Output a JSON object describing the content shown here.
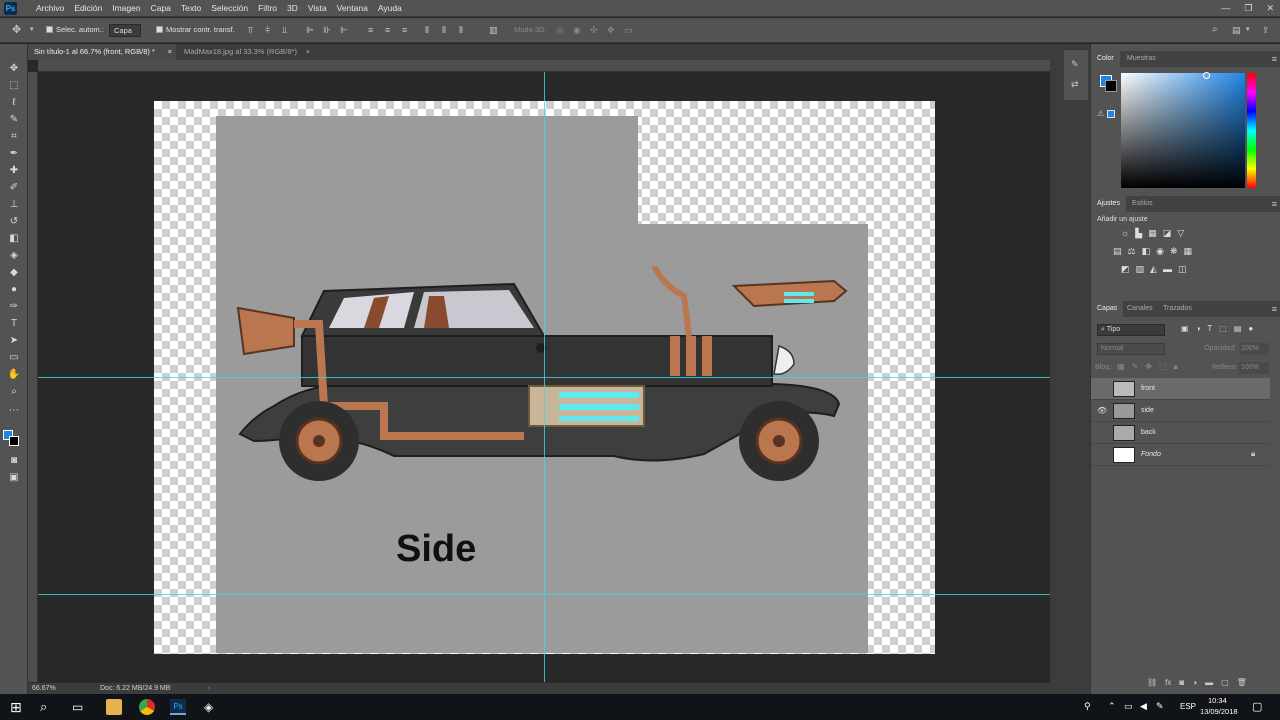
{
  "app": {
    "logo": "Ps"
  },
  "menu": [
    "Archivo",
    "Edición",
    "Imagen",
    "Capa",
    "Texto",
    "Selección",
    "Filtro",
    "3D",
    "Vista",
    "Ventana",
    "Ayuda"
  ],
  "window_controls": [
    "—",
    "❐",
    "✕"
  ],
  "options_bar": {
    "auto_select_label": "Selec. autom.:",
    "auto_select_value": "Capa",
    "show_transform_label": "Mostrar contr. transf.",
    "mode_3d_label": "Modo 3D:"
  },
  "tabs": [
    {
      "label": "Sin título-1 al 66.7% (front, RGB/8) *",
      "close": "×"
    },
    {
      "label": "MadMax18.jpg al 33.3% (RGB/8*)",
      "close": "×"
    }
  ],
  "canvas": {
    "text": "Side"
  },
  "status": {
    "zoom": "66.67%",
    "doc": "Doc: 6.22 MB/24.9 MB"
  },
  "color_panel": {
    "tabs": [
      "Color",
      "Muestras"
    ],
    "fg_color": "#1e86e6",
    "bg_color": "#000000"
  },
  "adjust_panel": {
    "tabs": [
      "Ajustes",
      "Estilos"
    ],
    "add_label": "Añadir un ajuste"
  },
  "layers_panel": {
    "tabs": [
      "Capas",
      "Canales",
      "Trazados"
    ],
    "filter_label": "Tipo",
    "blend_mode": "Normal",
    "opacity_label": "Opacidad:",
    "opacity_value": "100%",
    "lock_label": "Bloq.:",
    "fill_label": "Relleno:",
    "fill_value": "100%",
    "layers": [
      {
        "name": "front",
        "visible": false,
        "selected": true
      },
      {
        "name": "side",
        "visible": true,
        "selected": false
      },
      {
        "name": "back",
        "visible": false,
        "selected": false
      },
      {
        "name": "Fondo",
        "visible": false,
        "selected": false,
        "locked": true
      }
    ]
  },
  "taskbar": {
    "lang": "ESP",
    "time": "10:34",
    "date": "13/09/2018"
  },
  "colors": {
    "accent": "#31a8ff",
    "guide": "#3fd8e0",
    "panel": "#535353"
  }
}
